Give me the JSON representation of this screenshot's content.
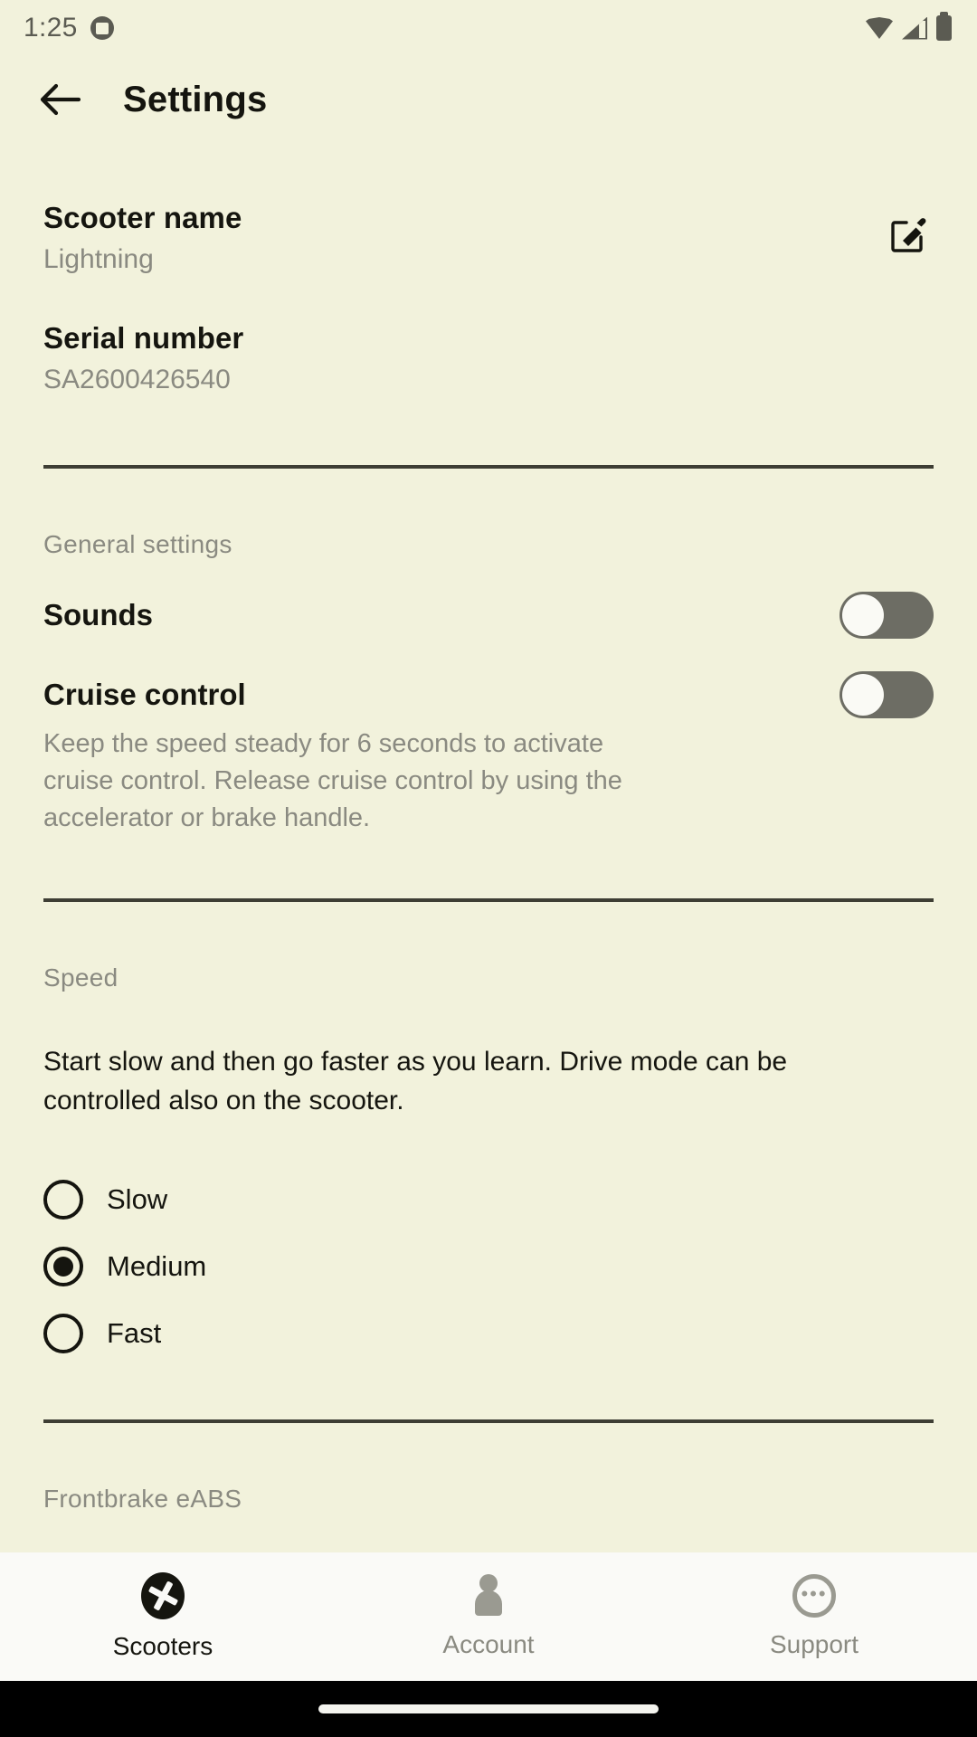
{
  "status_bar": {
    "time": "1:25",
    "notification_icon": "app-notification-icon",
    "wifi_icon": "wifi-icon",
    "signal_icon": "cellular-signal-icon",
    "battery_icon": "battery-icon"
  },
  "app_bar": {
    "back_icon": "back-arrow-icon",
    "title": "Settings"
  },
  "scooter_name": {
    "title": "Scooter name",
    "value": "Lightning",
    "edit_icon": "edit-pencil-icon"
  },
  "serial_number": {
    "title": "Serial number",
    "value": "SA2600426540"
  },
  "general_settings": {
    "label": "General settings",
    "sounds": {
      "label": "Sounds",
      "state": "off"
    },
    "cruise_control": {
      "label": "Cruise control",
      "state": "off",
      "description": "Keep the speed steady for 6 seconds to activate cruise control. Release cruise control by using the accelerator or brake handle."
    }
  },
  "speed": {
    "label": "Speed",
    "description": "Start slow and then go faster as you learn. Drive mode can be controlled also on the scooter.",
    "options": [
      {
        "label": "Slow",
        "selected": false
      },
      {
        "label": "Medium",
        "selected": true
      },
      {
        "label": "Fast",
        "selected": false
      }
    ]
  },
  "frontbrake": {
    "label": "Frontbrake eABS"
  },
  "bottom_nav": {
    "items": [
      {
        "label": "Scooters",
        "icon": "scooter-wheel-icon",
        "active": true
      },
      {
        "label": "Account",
        "icon": "person-icon",
        "active": false
      },
      {
        "label": "Support",
        "icon": "chat-bubble-icon",
        "active": false
      }
    ]
  },
  "colors": {
    "background": "#f2f2dc",
    "text_primary": "#15150f",
    "text_muted": "#8a8a81",
    "divider": "#3e3e34",
    "nav_background": "#fafaf7"
  }
}
